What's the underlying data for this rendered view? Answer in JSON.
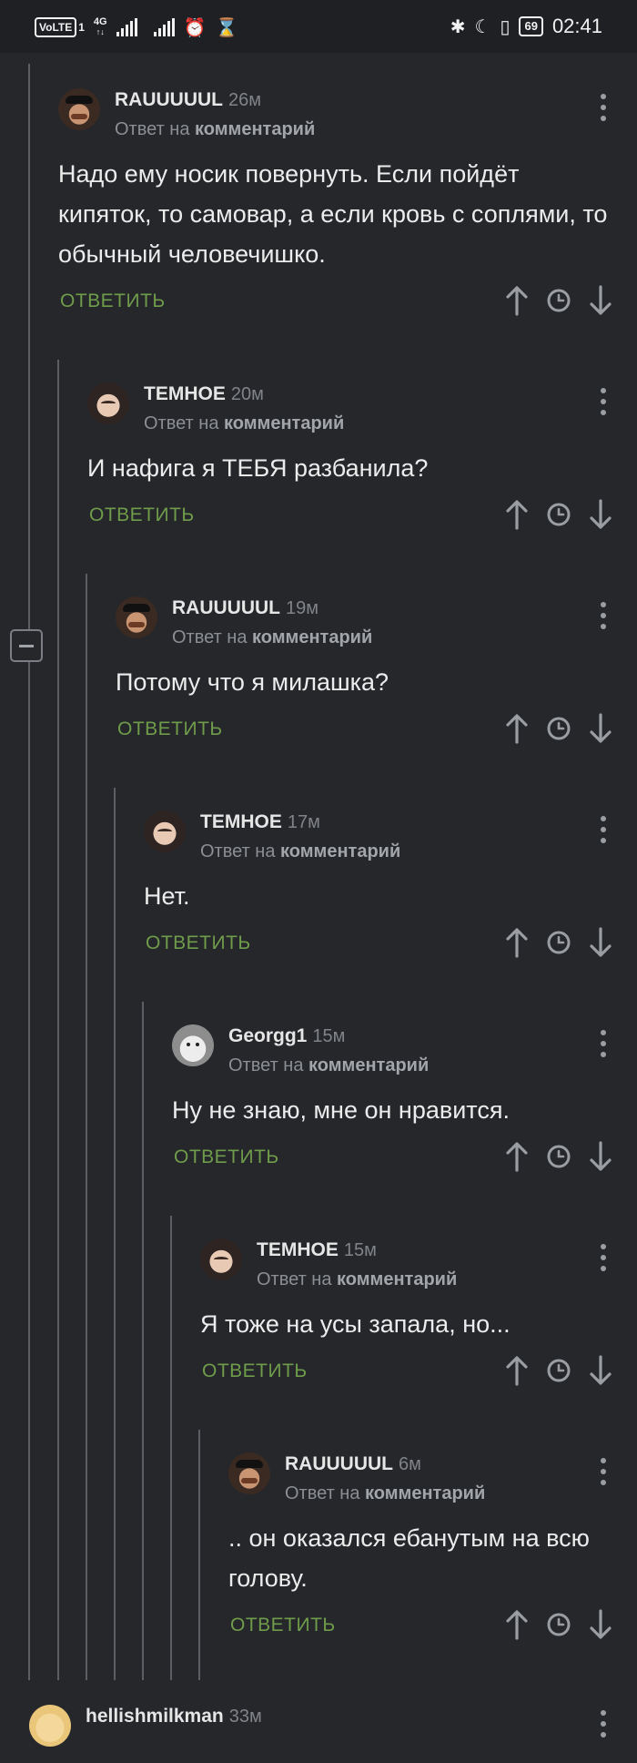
{
  "status_bar": {
    "volte": "VoLTE",
    "sim": "1",
    "network": "4G",
    "battery": "69",
    "time": "02:41"
  },
  "comments": [
    {
      "user": "RAUUUUUL",
      "time": "26м",
      "reply_prefix": "Ответ на",
      "reply_link": "комментарий",
      "text": "Надо ему носик повернуть. Если пойдёт кипяток, то самовар, а если кровь с соплями, то обычный человечишко.",
      "reply_label": "ОТВЕТИТЬ",
      "avatar": "rau"
    },
    {
      "user": "ТЕМНОЕ",
      "time": "20м",
      "reply_prefix": "Ответ на",
      "reply_link": "комментарий",
      "text": "И нафига я ТЕБЯ разбанила?",
      "reply_label": "ОТВЕТИТЬ",
      "avatar": "tem"
    },
    {
      "user": "RAUUUUUL",
      "time": "19м",
      "reply_prefix": "Ответ на",
      "reply_link": "комментарий",
      "text": "Потому что я милашка?",
      "reply_label": "ОТВЕТИТЬ",
      "avatar": "rau"
    },
    {
      "user": "ТЕМНОЕ",
      "time": "17м",
      "reply_prefix": "Ответ на",
      "reply_link": "комментарий",
      "text": "Нет.",
      "reply_label": "ОТВЕТИТЬ",
      "avatar": "tem"
    },
    {
      "user": "Georgg1",
      "time": "15м",
      "reply_prefix": "Ответ на",
      "reply_link": "комментарий",
      "text": "Ну не знаю, мне он нравится.",
      "reply_label": "ОТВЕТИТЬ",
      "avatar": "geo"
    },
    {
      "user": "ТЕМНОЕ",
      "time": "15м",
      "reply_prefix": "Ответ на",
      "reply_link": "комментарий",
      "text": "Я тоже на усы запала, но...",
      "reply_label": "ОТВЕТИТЬ",
      "avatar": "tem"
    },
    {
      "user": "RAUUUUUL",
      "time": "6м",
      "reply_prefix": "Ответ на",
      "reply_link": "комментарий",
      "text": ".. он оказался ебанутым на всю голову.",
      "reply_label": "ОТВЕТИТЬ",
      "avatar": "rau"
    }
  ],
  "next_comment": {
    "user": "hellishmilkman",
    "time": "33м",
    "avatar": "hel"
  }
}
